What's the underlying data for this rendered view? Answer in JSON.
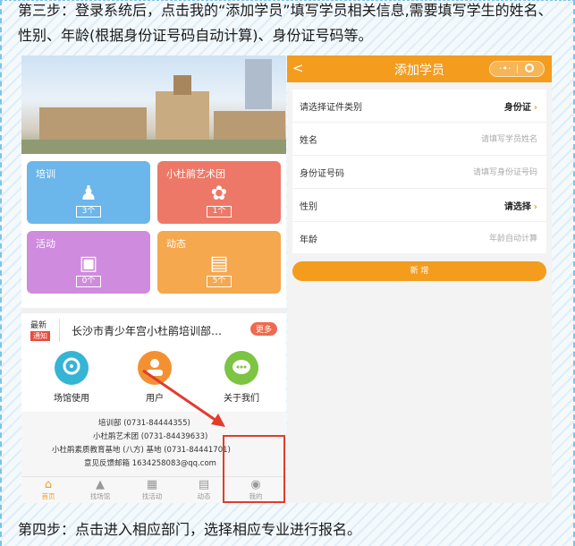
{
  "instructions": {
    "step3": "第三步：登录系统后，点击我的“添加学员”填写学员相关信息,需要填写学生的姓名、性别、年龄(根据身份证号码自动计算)、身份证号码等。",
    "step4": "第四步：点击进入相应部门，选择相应专业进行报名。"
  },
  "home": {
    "tiles": [
      {
        "title": "培训",
        "count": "3个",
        "icon": "people-icon",
        "color": "#6bb6ea"
      },
      {
        "title": "小杜鹃艺术团",
        "count": "1个",
        "icon": "flower-icon",
        "color": "#ee7867"
      },
      {
        "title": "活动",
        "count": "0个",
        "icon": "gift-icon",
        "color": "#cf8bdd"
      },
      {
        "title": "动态",
        "count": "5个",
        "icon": "news-icon",
        "color": "#f5a84d"
      }
    ],
    "news": {
      "latest": "最新",
      "badge": "通知",
      "text": "长沙市青少年宫小杜鹃培训部…",
      "more": "更多"
    },
    "shortcuts": [
      {
        "label": "场馆使用",
        "icon": "location-icon",
        "color": "#36b4d6"
      },
      {
        "label": "用户",
        "icon": "user-icon",
        "color": "#f39132"
      },
      {
        "label": "关于我们",
        "icon": "chat-icon",
        "color": "#7cc442"
      }
    ],
    "contacts": [
      "培训部 (0731-84444355)",
      "小杜鹃艺术团 (0731-84439633)",
      "小杜鹃素质教育基地 (八方) 基地 (0731-84441701)",
      "意见反馈邮箱  1634258083@qq.com"
    ],
    "tabbar": [
      {
        "label": "首页",
        "icon": "home-icon"
      },
      {
        "label": "找场馆",
        "icon": "venue-icon"
      },
      {
        "label": "找活动",
        "icon": "activity-icon"
      },
      {
        "label": "动态",
        "icon": "feed-icon"
      },
      {
        "label": "我的",
        "icon": "profile-icon"
      }
    ]
  },
  "add_student": {
    "title": "添加学员",
    "back": "<",
    "fields": [
      {
        "label": "请选择证件类别",
        "value": "身份证",
        "style": "select"
      },
      {
        "label": "姓名",
        "value": "请填写学员姓名",
        "style": "placeholder"
      },
      {
        "label": "身份证号码",
        "value": "请填写身份证号码",
        "style": "placeholder"
      },
      {
        "label": "性别",
        "value": "请选择",
        "style": "select"
      },
      {
        "label": "年龄",
        "value": "年龄自动计算",
        "style": "placeholder"
      }
    ],
    "submit": "新 增"
  },
  "colors": {
    "accent": "#f39c1e",
    "annotation": "#e23b2e"
  }
}
